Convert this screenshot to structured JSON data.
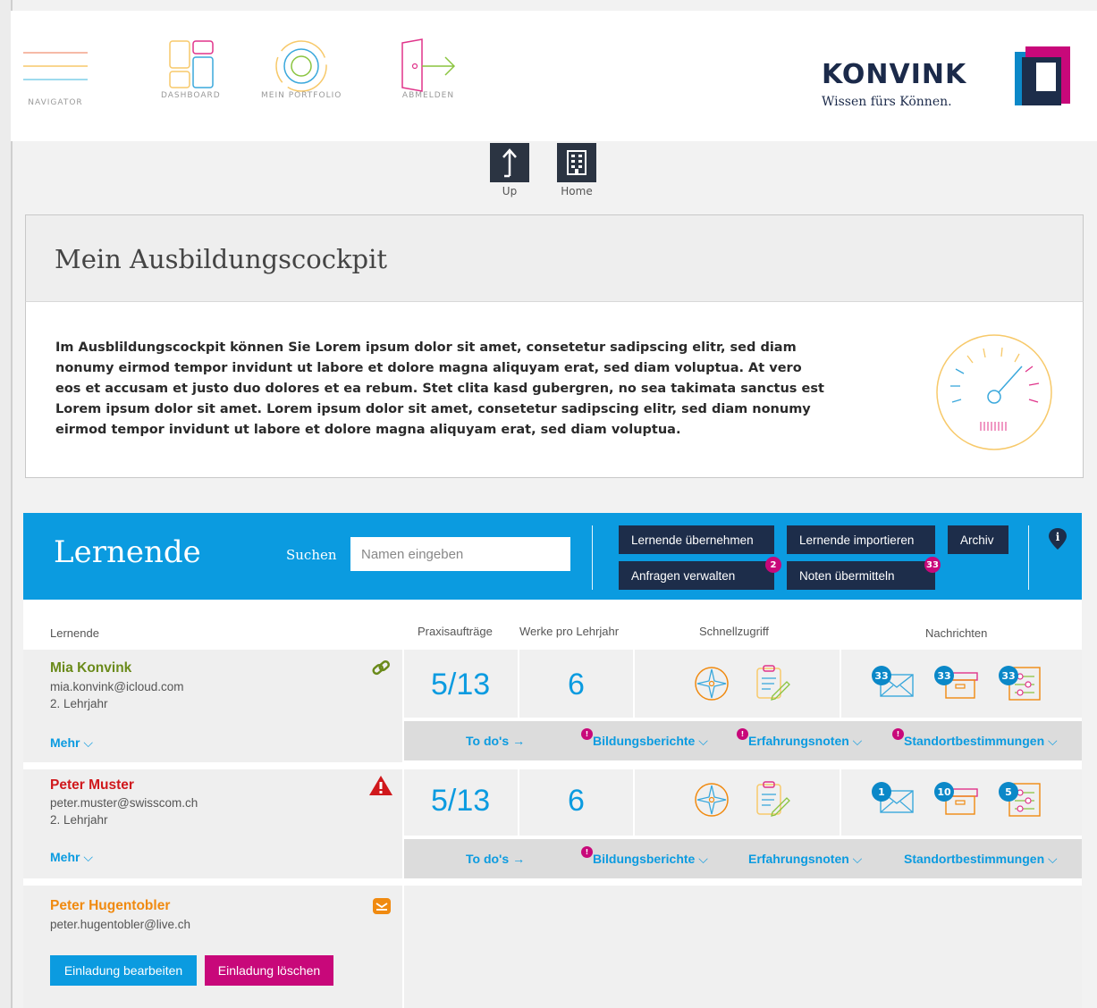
{
  "nav": {
    "items": [
      {
        "label": "NAVIGATOR",
        "icon": "menu-lines-icon"
      },
      {
        "label": "DASHBOARD",
        "icon": "dashboard-tiles-icon"
      },
      {
        "label": "MEIN PORTFOLIO",
        "icon": "portfolio-circles-icon"
      },
      {
        "label": "ABMELDEN",
        "icon": "logout-door-icon"
      }
    ]
  },
  "brand": {
    "name": "KONVINK",
    "tagline": "Wissen fürs Können."
  },
  "quicknav": {
    "up": "Up",
    "home": "Home"
  },
  "cockpit": {
    "title": "Mein Ausbildungscockpit",
    "text": "Im Ausblildungscockpit können Sie Lorem ipsum dolor sit amet, consetetur sadipscing elitr, sed diam nonumy eirmod tempor invidunt ut labore et dolore magna aliquyam erat, sed diam voluptua. At vero eos et accusam et justo duo dolores et ea rebum. Stet clita kasd gubergren, no sea takimata sanctus est Lorem ipsum dolor sit amet. Lorem ipsum dolor sit amet, consetetur sadipscing elitr, sed diam nonumy eirmod tempor invidunt ut labore et dolore magna aliquyam erat, sed diam voluptua."
  },
  "lernende": {
    "title": "Lernende",
    "search_label": "Suchen",
    "search_placeholder": "Namen eingeben",
    "buttons": {
      "uebernehmen": "Lernende übernehmen",
      "importieren": "Lernende importieren",
      "archiv": "Archiv",
      "anfragen": "Anfragen verwalten",
      "anfragen_badge": "2",
      "noten": "Noten übermitteln",
      "noten_badge": "33"
    },
    "columns": {
      "lernende": "Lernende",
      "praxis": "Praxisaufträge",
      "werke": "Werke pro Lehrjahr",
      "schnell": "Schnellzugriff",
      "nachrichten": "Nachrichten"
    },
    "rows": [
      {
        "name": "Mia Konvink",
        "email": "mia.konvink@icloud.com",
        "year": "2. Lehrjahr",
        "status_icon": "link-icon",
        "more": "Mehr",
        "praxis": "5/13",
        "werke": "6",
        "msg_mail": "33",
        "msg_box": "33",
        "msg_settings": "33",
        "todo": "To do's →",
        "bildung": "Bildungsberichte",
        "erfahrung": "Erfahrungsnoten",
        "standort": "Standortbestimmungen",
        "dot_mark": "!"
      },
      {
        "name": "Peter Muster",
        "email": "peter.muster@swisscom.ch",
        "year": "2. Lehrjahr",
        "status_icon": "warning-icon",
        "more": "Mehr",
        "praxis": "5/13",
        "werke": "6",
        "msg_mail": "1",
        "msg_box": "10",
        "msg_settings": "5",
        "todo": "To do's →",
        "bildung": "Bildungsberichte",
        "erfahrung": "Erfahrungsnoten",
        "standort": "Standortbestimmungen",
        "dot_mark": "!"
      },
      {
        "name": "Peter Hugentobler",
        "email": "peter.hugentobler@live.ch",
        "status_icon": "invitation-mail-icon",
        "edit_invite": "Einladung bearbeiten",
        "delete_invite": "Einladung löschen"
      }
    ]
  },
  "colors": {
    "primary": "#0b9be0",
    "dark_button": "#1d2d4a",
    "accent_pink": "#c8087a",
    "green_name": "#6a8a1a",
    "red_name": "#d0181c",
    "orange_name": "#f08a10"
  }
}
